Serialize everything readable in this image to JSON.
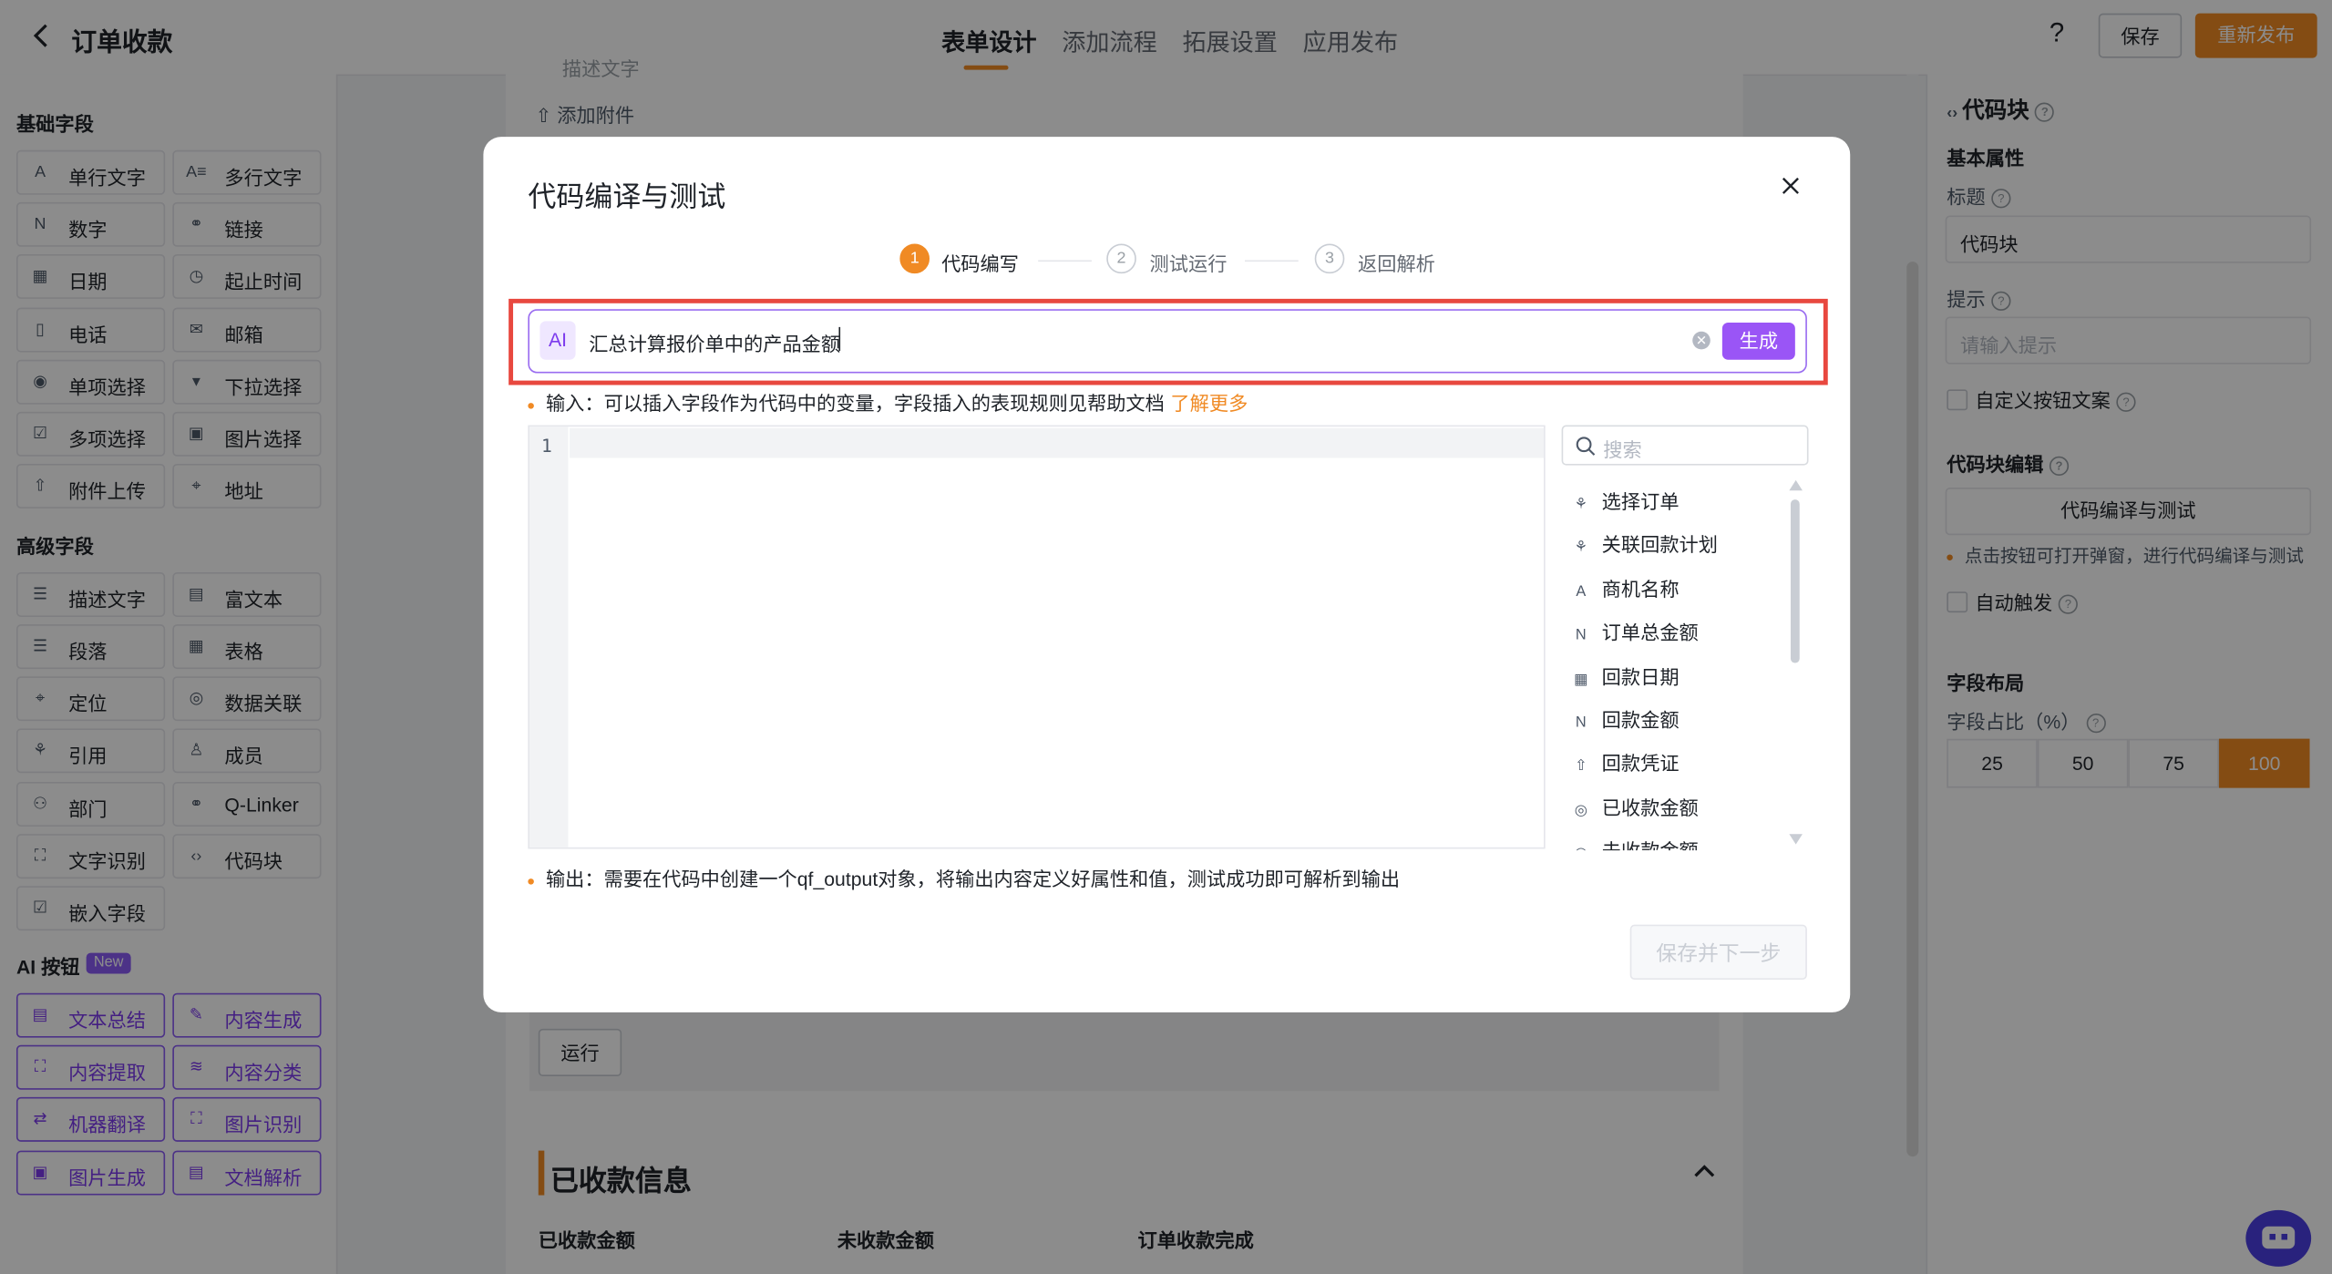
{
  "header": {
    "app_title": "订单收款",
    "tabs": [
      {
        "label": "表单设计",
        "active": true
      },
      {
        "label": "添加流程",
        "active": false
      },
      {
        "label": "拓展设置",
        "active": false
      },
      {
        "label": "应用发布",
        "active": false
      }
    ],
    "help_glyph": "?",
    "save_label": "保存",
    "publish_label": "重新发布"
  },
  "sidebar": {
    "basic_title": "基础字段",
    "basic_fields": [
      {
        "label": "单行文字",
        "icon": "text-line-icon",
        "glyph": "A"
      },
      {
        "label": "多行文字",
        "icon": "text-multiline-icon",
        "glyph": "A≡"
      },
      {
        "label": "数字",
        "icon": "number-icon",
        "glyph": "N"
      },
      {
        "label": "链接",
        "icon": "link-icon",
        "glyph": "⚭"
      },
      {
        "label": "日期",
        "icon": "calendar-icon",
        "glyph": "▦"
      },
      {
        "label": "起止时间",
        "icon": "clock-icon",
        "glyph": "◷"
      },
      {
        "label": "电话",
        "icon": "phone-icon",
        "glyph": "▯"
      },
      {
        "label": "邮箱",
        "icon": "mail-icon",
        "glyph": "✉"
      },
      {
        "label": "单项选择",
        "icon": "radio-icon",
        "glyph": "◉"
      },
      {
        "label": "下拉选择",
        "icon": "dropdown-icon",
        "glyph": "▾"
      },
      {
        "label": "多项选择",
        "icon": "checkbox-icon",
        "glyph": "☑"
      },
      {
        "label": "图片选择",
        "icon": "image-icon",
        "glyph": "▣"
      },
      {
        "label": "附件上传",
        "icon": "upload-icon",
        "glyph": "⇧"
      },
      {
        "label": "地址",
        "icon": "location-icon",
        "glyph": "⌖"
      }
    ],
    "advanced_title": "高级字段",
    "advanced_fields": [
      {
        "label": "描述文字",
        "icon": "description-icon",
        "glyph": "☰"
      },
      {
        "label": "富文本",
        "icon": "richtext-icon",
        "glyph": "▤"
      },
      {
        "label": "段落",
        "icon": "paragraph-icon",
        "glyph": "☰"
      },
      {
        "label": "表格",
        "icon": "table-icon",
        "glyph": "▦"
      },
      {
        "label": "定位",
        "icon": "position-icon",
        "glyph": "⌖"
      },
      {
        "label": "数据关联",
        "icon": "data-link-icon",
        "glyph": "◎"
      },
      {
        "label": "引用",
        "icon": "reference-icon",
        "glyph": "⚘"
      },
      {
        "label": "成员",
        "icon": "member-icon",
        "glyph": "♙"
      },
      {
        "label": "部门",
        "icon": "department-icon",
        "glyph": "⚇"
      },
      {
        "label": "Q-Linker",
        "icon": "qlinker-icon",
        "glyph": "⚭"
      },
      {
        "label": "文字识别",
        "icon": "ocr-icon",
        "glyph": "⛶"
      },
      {
        "label": "代码块",
        "icon": "code-icon",
        "glyph": "‹›"
      },
      {
        "label": "嵌入字段",
        "icon": "embed-icon",
        "glyph": "☑"
      }
    ],
    "ai_title": "AI 按钮",
    "ai_badge": "New",
    "ai_fields": [
      {
        "label": "文本总结",
        "icon": "summary-icon",
        "glyph": "▤"
      },
      {
        "label": "内容生成",
        "icon": "generate-icon",
        "glyph": "✎"
      },
      {
        "label": "内容提取",
        "icon": "extract-icon",
        "glyph": "⛶"
      },
      {
        "label": "内容分类",
        "icon": "classify-icon",
        "glyph": "≋"
      },
      {
        "label": "机器翻译",
        "icon": "translate-icon",
        "glyph": "⇄"
      },
      {
        "label": "图片识别",
        "icon": "image-recognition-icon",
        "glyph": "⛶"
      },
      {
        "label": "图片生成",
        "icon": "image-generate-icon",
        "glyph": "▣"
      },
      {
        "label": "文档解析",
        "icon": "document-parse-icon",
        "glyph": "▤"
      }
    ]
  },
  "canvas": {
    "faded_item_1": "描述文字",
    "faded_item_2": "添加附件",
    "run_label": "运行",
    "section_title": "已收款信息",
    "columns": [
      "已收款金额",
      "未收款金额",
      "订单收款完成"
    ]
  },
  "right_panel": {
    "title": "代码块",
    "basic_props": "基本属性",
    "title_label": "标题",
    "title_value": "代码块",
    "hint_label": "提示",
    "hint_placeholder": "请输入提示",
    "custom_button_text": "自定义按钮文案",
    "code_edit_title": "代码块编辑",
    "code_edit_button": "代码编译与测试",
    "code_edit_note": "点击按钮可打开弹窗，进行代码编译与测试",
    "auto_trigger": "自动触发",
    "layout_title": "字段布局",
    "ratio_label": "字段占比（%）",
    "ratio_options": [
      "25",
      "50",
      "75",
      "100"
    ],
    "ratio_selected": "100"
  },
  "modal": {
    "title": "代码编译与测试",
    "steps": [
      {
        "num": "1",
        "label": "代码编写",
        "active": true
      },
      {
        "num": "2",
        "label": "测试运行",
        "active": false
      },
      {
        "num": "3",
        "label": "返回解析",
        "active": false
      }
    ],
    "ai_chip": "AI",
    "ai_prompt_value": "汇总计算报价单中的产品金额",
    "generate_label": "生成",
    "input_hint": "输入：可以插入字段作为代码中的变量，字段插入的表现规则见帮助文档",
    "learn_more": "了解更多",
    "line_number": "1",
    "search_placeholder": "搜索",
    "variables": [
      {
        "label": "选择订单",
        "icon": "reference-icon",
        "glyph": "⚘"
      },
      {
        "label": "关联回款计划",
        "icon": "reference-icon",
        "glyph": "⚘"
      },
      {
        "label": "商机名称",
        "icon": "text-line-icon",
        "glyph": "A"
      },
      {
        "label": "订单总金额",
        "icon": "number-icon",
        "glyph": "N"
      },
      {
        "label": "回款日期",
        "icon": "calendar-icon",
        "glyph": "▦"
      },
      {
        "label": "回款金额",
        "icon": "number-icon",
        "glyph": "N"
      },
      {
        "label": "回款凭证",
        "icon": "upload-icon",
        "glyph": "⇧"
      },
      {
        "label": "已收款金额",
        "icon": "data-link-icon",
        "glyph": "◎"
      },
      {
        "label": "未收款金额",
        "icon": "data-link-icon",
        "glyph": "◎"
      }
    ],
    "output_hint": "输出：需要在代码中创建一个qf_output对象，将输出内容定义好属性和值，测试成功即可解析到输出",
    "next_label": "保存并下一步"
  },
  "colors": {
    "accent": "#f08a24",
    "ai_purple": "#9a55f6",
    "highlight_red": "#e8483f"
  }
}
